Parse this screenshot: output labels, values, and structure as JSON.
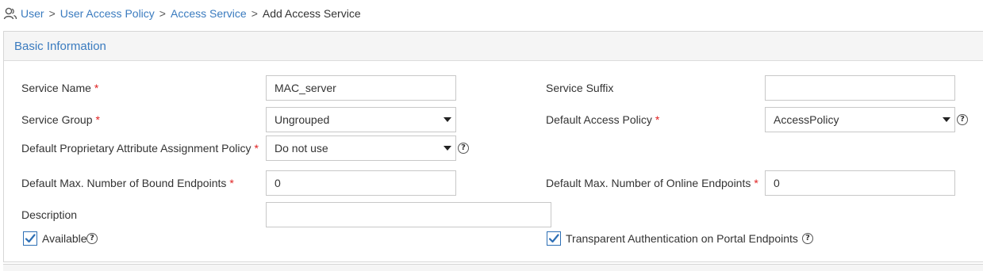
{
  "breadcrumb": {
    "icon": "user-icon",
    "items": [
      "User",
      "User Access Policy",
      "Access Service"
    ],
    "separator": ">",
    "current": "Add Access Service"
  },
  "panel": {
    "title": "Basic Information"
  },
  "form": {
    "service_name": {
      "label": "Service Name",
      "required": "*",
      "value": "MAC_server"
    },
    "service_suffix": {
      "label": "Service Suffix",
      "value": ""
    },
    "service_group": {
      "label": "Service Group",
      "required": "*",
      "value": "Ungrouped"
    },
    "default_access_policy": {
      "label": "Default Access Policy",
      "required": "*",
      "value": "AccessPolicy"
    },
    "default_proprietary_policy": {
      "label": "Default Proprietary Attribute Assignment Policy",
      "required": "*",
      "value": "Do not use"
    },
    "max_bound_endpoints": {
      "label": "Default Max. Number of Bound Endpoints",
      "required": "*",
      "value": "0"
    },
    "max_online_endpoints": {
      "label": "Default Max. Number of Online Endpoints",
      "required": "*",
      "value": "0"
    },
    "description": {
      "label": "Description",
      "value": ""
    },
    "available": {
      "label": "Available",
      "checked": true
    },
    "transparent_auth": {
      "label": "Transparent Authentication on Portal Endpoints",
      "checked": true
    }
  },
  "help_glyph": "?",
  "colors": {
    "link": "#3a7bbf",
    "required": "#e02020",
    "checkbox": "#2d6fb5"
  }
}
